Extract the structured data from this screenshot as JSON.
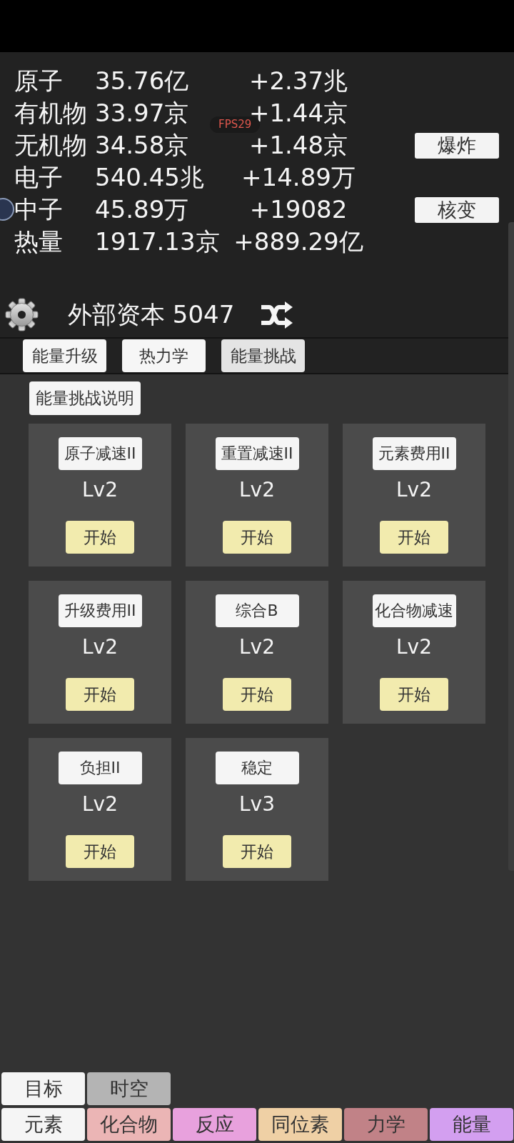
{
  "stats": [
    {
      "label": "原子",
      "value": "35.76亿",
      "rate": "+2.37兆"
    },
    {
      "label": "有机物",
      "value": "33.97京",
      "rate": "+1.44京"
    },
    {
      "label": "无机物",
      "value": "34.58京",
      "rate": "+1.48京",
      "button": "爆炸"
    },
    {
      "label": "电子",
      "value": "540.45兆",
      "rate": "+14.89万"
    },
    {
      "label": "中子",
      "value": "45.89万",
      "rate": "+19082",
      "button": "核变"
    },
    {
      "label": "热量",
      "value": "1917.13京",
      "rate": "+889.29亿"
    }
  ],
  "fps_badge": "FPS29",
  "capital": "外部资本 5047",
  "tabs": [
    {
      "label": "能量升级",
      "selected": false
    },
    {
      "label": "热力学",
      "selected": false
    },
    {
      "label": "能量挑战",
      "selected": true
    }
  ],
  "help_button": "能量挑战说明",
  "challenges": [
    {
      "name": "原子减速II",
      "rank": "Lv2",
      "action": "开始"
    },
    {
      "name": "重置减速II",
      "rank": "Lv2",
      "action": "开始"
    },
    {
      "name": "元素费用II",
      "rank": "Lv2",
      "action": "开始"
    },
    {
      "name": "升级费用II",
      "rank": "Lv2",
      "action": "开始"
    },
    {
      "name": "综合B",
      "rank": "Lv2",
      "action": "开始"
    },
    {
      "name": "化合物减速",
      "rank": "Lv2",
      "action": "开始"
    },
    {
      "name": "负担II",
      "rank": "Lv2",
      "action": "开始"
    },
    {
      "name": "稳定",
      "rank": "Lv3",
      "action": "开始"
    }
  ],
  "nav_rows": [
    {
      "tabs": [
        {
          "label": "目标",
          "color": "#f5f5f5"
        },
        {
          "label": "时空",
          "color": "#b4b4b4"
        }
      ]
    },
    {
      "tabs": [
        {
          "label": "元素",
          "color": "#f5f5f5"
        },
        {
          "label": "化合物",
          "color": "#ebb5b5"
        },
        {
          "label": "反应",
          "color": "#e8a1dd"
        },
        {
          "label": "同位素",
          "color": "#efd0a5"
        },
        {
          "label": "力学",
          "color": "#c18287"
        },
        {
          "label": "能量",
          "color": "#d39ff0"
        }
      ]
    }
  ]
}
